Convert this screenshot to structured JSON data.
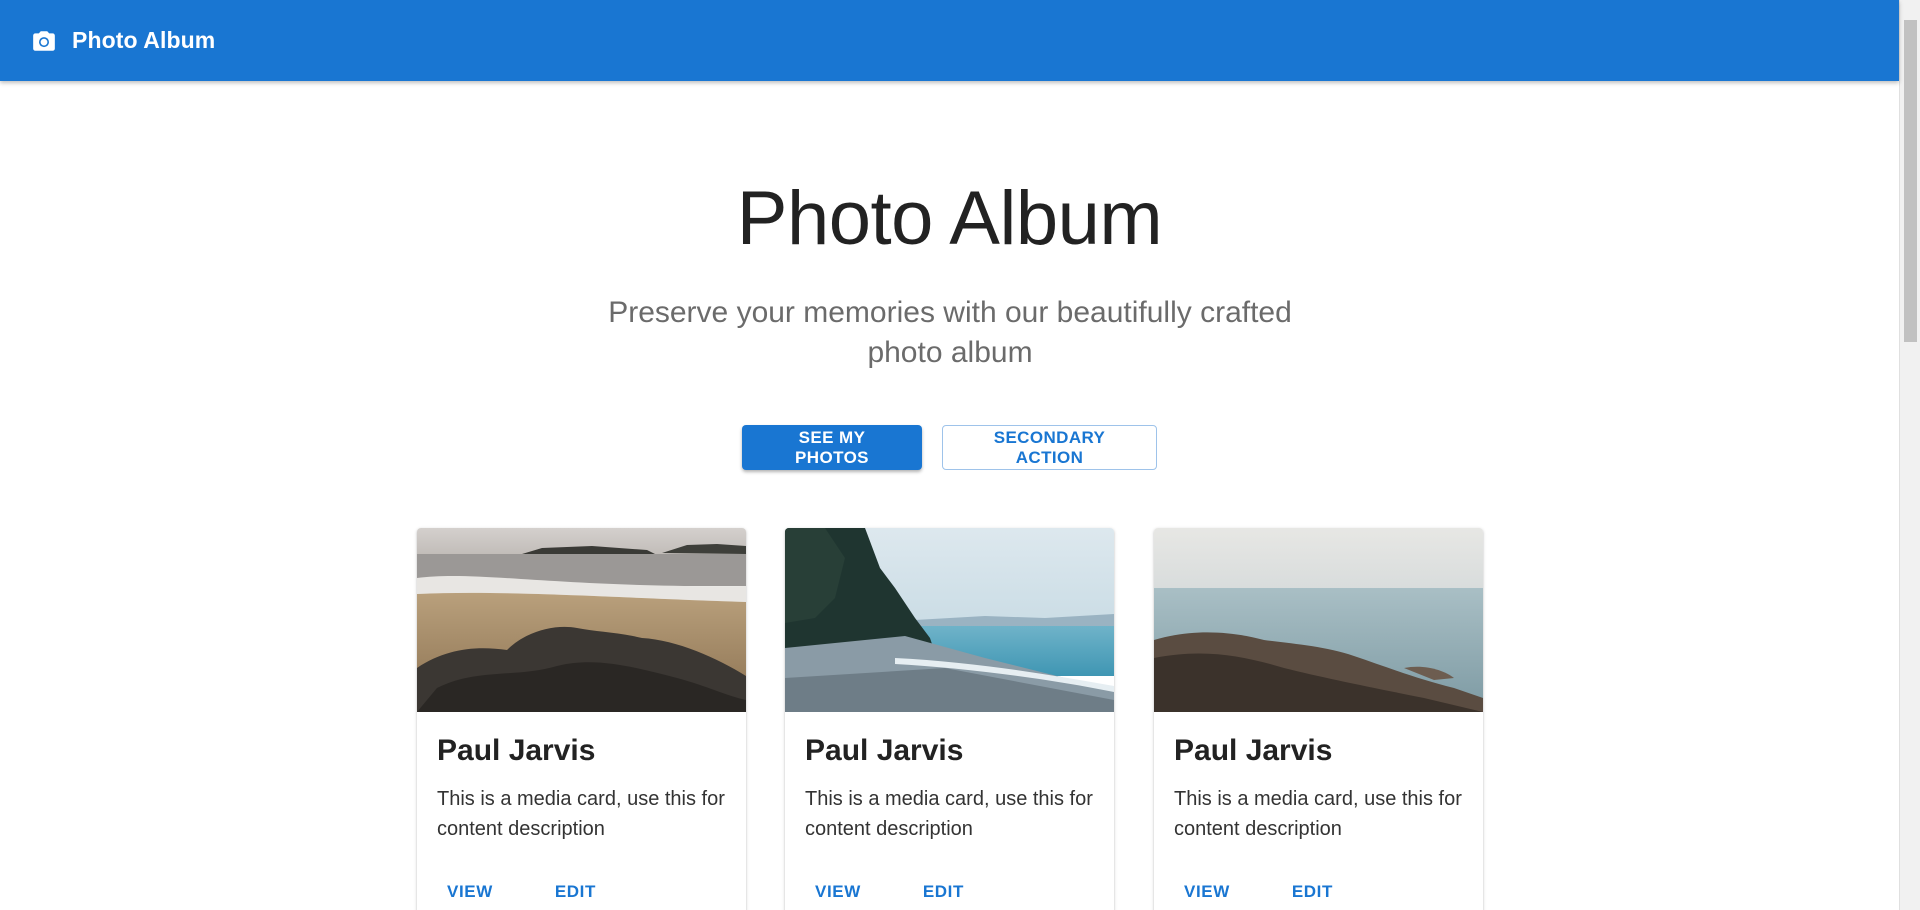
{
  "appbar": {
    "icon": "camera-icon",
    "title": "Photo Album",
    "color": "#1976d2"
  },
  "hero": {
    "title": "Photo Album",
    "subtitle": "Preserve your memories with our beautifully crafted photo album",
    "primary_button": "SEE MY PHOTOS",
    "secondary_button": "SECONDARY ACTION"
  },
  "cards": [
    {
      "image": "beach-rocks-photo",
      "title": "Paul Jarvis",
      "description": "This is a media card, use this for content description",
      "view_label": "VIEW",
      "edit_label": "EDIT"
    },
    {
      "image": "pebble-shore-trees-photo",
      "title": "Paul Jarvis",
      "description": "This is a media card, use this for content description",
      "view_label": "VIEW",
      "edit_label": "EDIT"
    },
    {
      "image": "rocky-sea-coast-photo",
      "title": "Paul Jarvis",
      "description": "This is a media card, use this for content description",
      "view_label": "VIEW",
      "edit_label": "EDIT"
    }
  ],
  "colors": {
    "accent": "#1976d2",
    "title_text": "#222222",
    "subtitle_text": "#6b6b6b"
  }
}
